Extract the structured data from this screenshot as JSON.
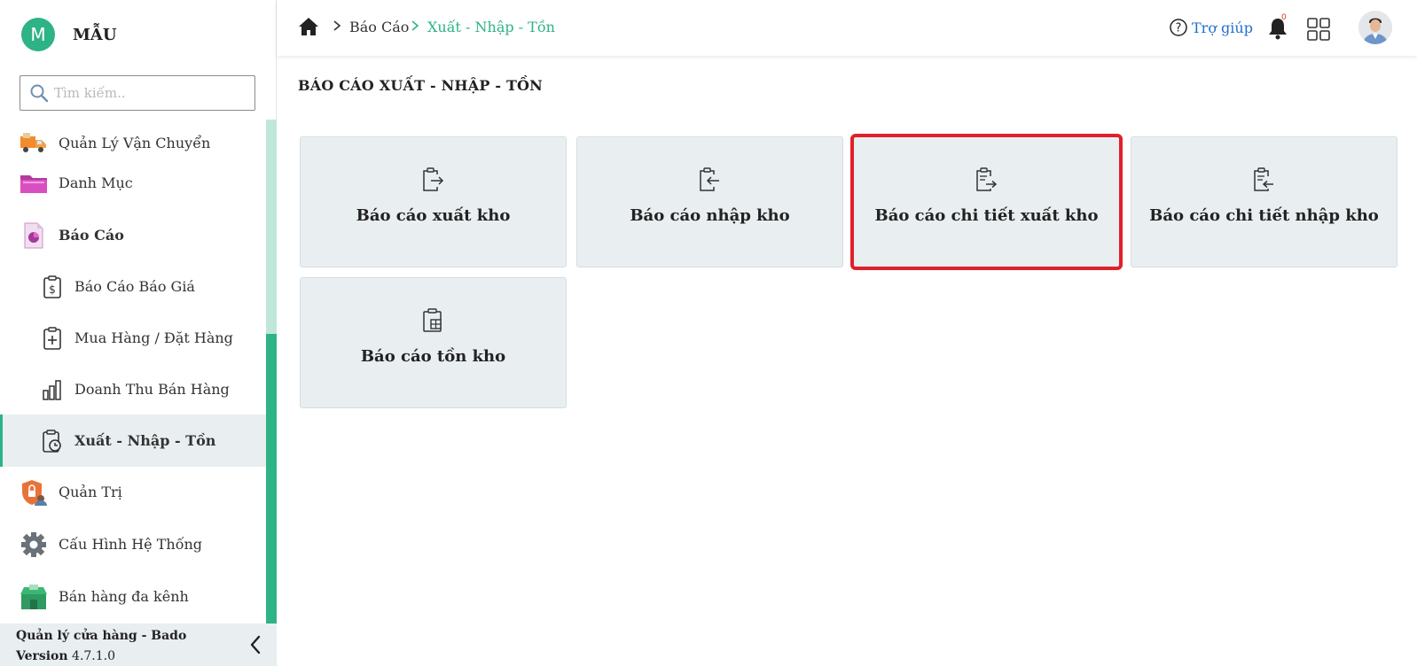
{
  "brand": {
    "initial": "M",
    "name": "MẪU"
  },
  "search": {
    "placeholder": "Tìm kiếm.."
  },
  "sidebar": {
    "items": [
      {
        "label": "Quản Lý Vận Chuyển",
        "icon": "delivery-truck-icon"
      },
      {
        "label": "Danh Mục",
        "icon": "folder-icon"
      },
      {
        "label": "Báo Cáo",
        "icon": "report-document-icon"
      },
      {
        "label": "Báo Cáo Báo Giá",
        "icon": "clipboard-dollar-icon"
      },
      {
        "label": "Mua Hàng / Đặt Hàng",
        "icon": "clipboard-plus-icon"
      },
      {
        "label": "Doanh Thu Bán Hàng",
        "icon": "bar-chart-icon"
      },
      {
        "label": "Xuất - Nhập - Tồn",
        "icon": "clipboard-clock-icon"
      },
      {
        "label": "Quản Trị",
        "icon": "shield-lock-icon"
      },
      {
        "label": "Cấu Hình Hệ Thống",
        "icon": "gear-icon"
      },
      {
        "label": "Bán hàng đa kênh",
        "icon": "store-icon"
      }
    ]
  },
  "footer": {
    "app_name": "Quản lý cửa hàng - Bado",
    "version_label": "Version",
    "version": "4.7.1.0"
  },
  "header": {
    "breadcrumb": [
      "Báo Cáo",
      "Xuất - Nhập - Tồn"
    ],
    "help_label": "Trợ giúp",
    "notification_count": "0"
  },
  "main": {
    "title": "BÁO CÁO XUẤT - NHẬP - TỒN",
    "cards": [
      {
        "label": "Báo cáo xuất kho",
        "icon": "clipboard-export-icon"
      },
      {
        "label": "Báo cáo nhập kho",
        "icon": "clipboard-import-icon"
      },
      {
        "label": "Báo cáo chi tiết xuất kho",
        "icon": "clipboard-list-export-icon"
      },
      {
        "label": "Báo cáo chi tiết nhập kho",
        "icon": "clipboard-list-import-icon"
      },
      {
        "label": "Báo cáo tồn kho",
        "icon": "clipboard-inventory-icon"
      }
    ]
  },
  "colors": {
    "accent": "#2db386",
    "link": "#1f6fd1",
    "highlight": "#e0202a",
    "card_bg": "#e9eef1"
  }
}
